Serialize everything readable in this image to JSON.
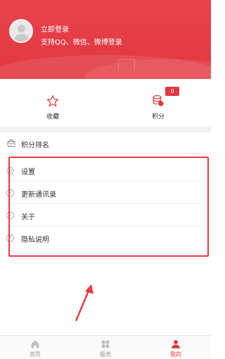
{
  "header": {
    "login_title": "立即登录",
    "login_subtitle": "支持QQ、微信、微博登录",
    "bg_color": "#e2373f"
  },
  "stats": {
    "favorites": {
      "label": "收藏",
      "icon": "star-icon"
    },
    "points": {
      "label": "积分",
      "icon": "coins-icon",
      "badge": "0"
    }
  },
  "rank": {
    "label": "积分排名",
    "icon": "ranking-icon"
  },
  "menu": {
    "items": [
      {
        "label": "设置",
        "icon": "gear-icon"
      },
      {
        "label": "更新通讯录",
        "icon": "info-icon"
      },
      {
        "label": "关于",
        "icon": "info-icon"
      },
      {
        "label": "隐私说明",
        "icon": "question-icon"
      }
    ]
  },
  "tabbar": {
    "items": [
      {
        "label": "首页",
        "icon": "home-icon",
        "active": false
      },
      {
        "label": "服务",
        "icon": "grid-icon",
        "active": false
      },
      {
        "label": "我的",
        "icon": "user-icon",
        "active": true
      }
    ],
    "active_color": "#e2373f",
    "inactive_color": "#999999"
  },
  "annotation": {
    "color": "#e53b44"
  }
}
